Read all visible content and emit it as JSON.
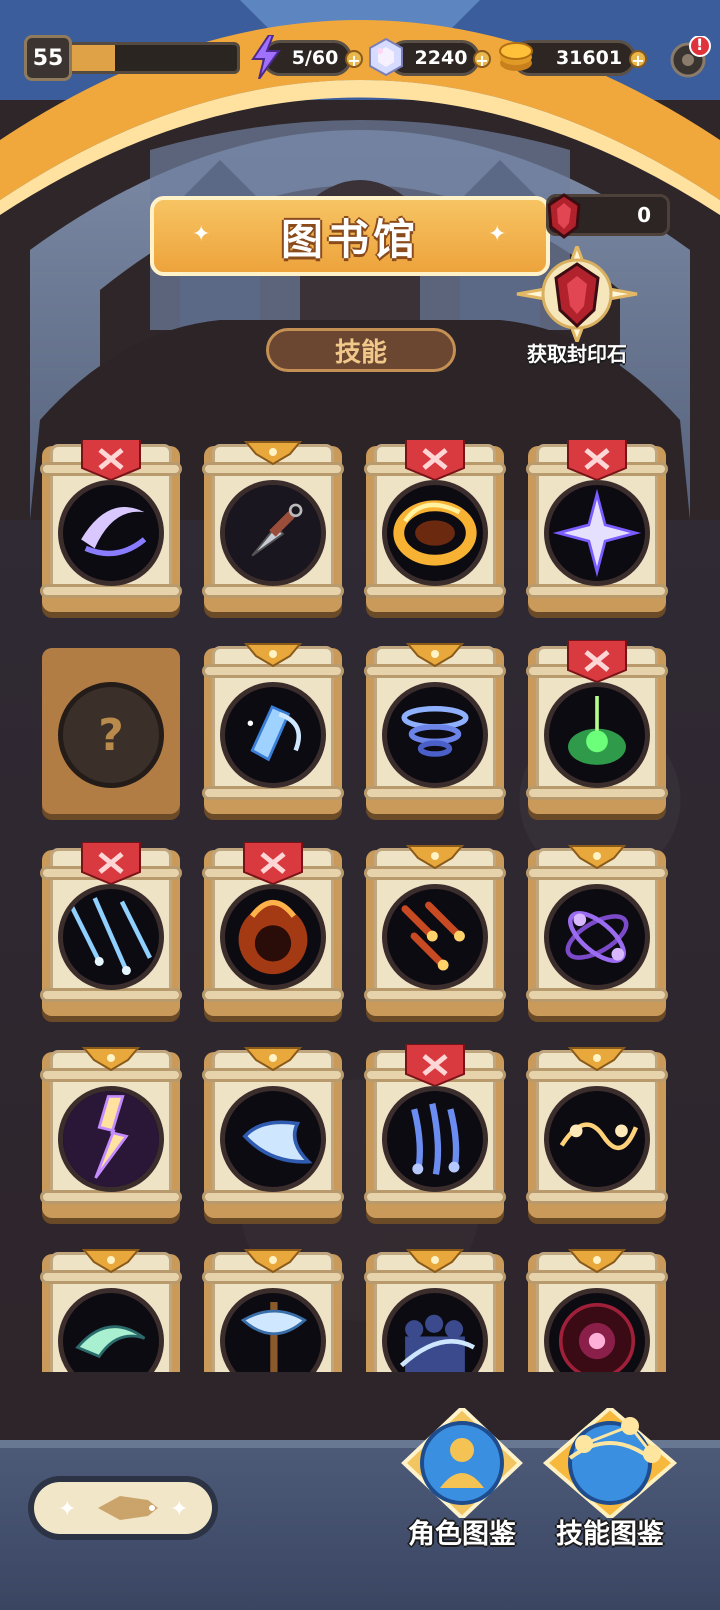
{
  "header": {
    "level": "55",
    "xp_fraction": 0.3,
    "energy": "5/60",
    "gems": "2240",
    "coins": "31601",
    "plus_symbol": "+",
    "settings_alert": "!"
  },
  "title": {
    "text": "图书馆",
    "subtab": "技能"
  },
  "seal": {
    "count": "0",
    "button_label": "获取封印石"
  },
  "cards": [
    {
      "tag": "red",
      "icon": "crescent-slash-icon"
    },
    {
      "tag": "gold",
      "icon": "kunai-icon"
    },
    {
      "tag": "red",
      "icon": "fire-ring-icon"
    },
    {
      "tag": "red",
      "icon": "four-point-star-icon"
    },
    {
      "tag": "none",
      "icon": "question-mark-icon",
      "locked": true,
      "label": "?"
    },
    {
      "tag": "gold",
      "icon": "ice-shard-icon"
    },
    {
      "tag": "gold",
      "icon": "tornado-icon"
    },
    {
      "tag": "red",
      "icon": "poison-cauldron-icon"
    },
    {
      "tag": "red",
      "icon": "ice-rain-icon"
    },
    {
      "tag": "red",
      "icon": "fire-vortex-icon"
    },
    {
      "tag": "gold",
      "icon": "meteor-shower-icon"
    },
    {
      "tag": "gold",
      "icon": "orbit-orbs-icon"
    },
    {
      "tag": "gold",
      "icon": "lightning-strike-icon"
    },
    {
      "tag": "gold",
      "icon": "boomerang-icon"
    },
    {
      "tag": "red",
      "icon": "spirit-claw-icon"
    },
    {
      "tag": "gold",
      "icon": "chain-lightning-icon"
    },
    {
      "tag": "gold",
      "icon": "wind-dragon-icon"
    },
    {
      "tag": "gold",
      "icon": "battle-axe-icon"
    },
    {
      "tag": "gold",
      "icon": "shadow-clone-icon"
    },
    {
      "tag": "gold",
      "icon": "blood-eye-icon"
    }
  ],
  "bottom_nav": {
    "character_label": "角色图鉴",
    "skill_label": "技能图鉴"
  },
  "colors": {
    "accent_orange": "#eda33c",
    "tag_red": "#d93a3f",
    "tag_gold": "#e9a83b"
  }
}
